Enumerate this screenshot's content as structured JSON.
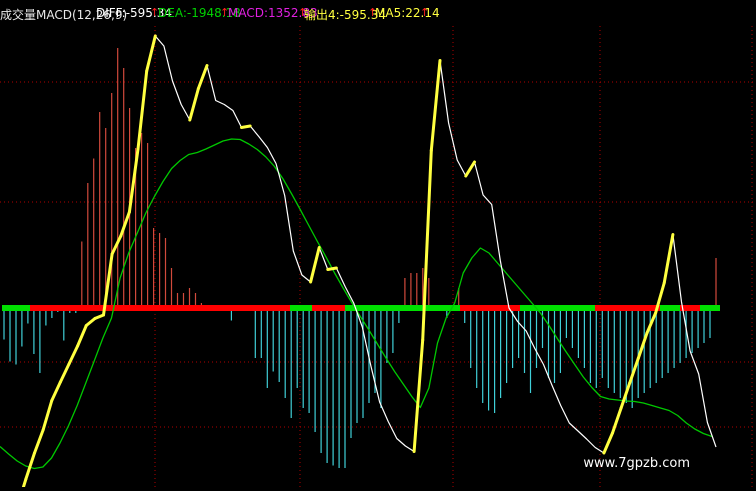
{
  "legend": {
    "title": "成交量MACD(12,26,9)",
    "diff": "DIFF:-595.34",
    "dea": "DEA:-1948.18",
    "macd": "MACD:1352.83",
    "out4": "输出4:-595.34",
    "ma5": "MA5:22.14"
  },
  "watermark": "www.7gpzb.com",
  "colors": {
    "background": "#000000",
    "title": "#e8e8e8",
    "diff": "#ffffff",
    "dea": "#00d000",
    "macd": "#e020e0",
    "out4": "#ffff40",
    "ma5": "#ffff40",
    "bar_positive": "#d24a3c",
    "bar_negative": "#40d0d8",
    "zero_red": "#ff0000",
    "zero_green": "#00e000",
    "line_yellow": "#ffff40",
    "line_white": "#ffffff",
    "line_green": "#00c800",
    "grid": "#b00000"
  },
  "chart_data": {
    "type": "line",
    "title": "成交量MACD(12,26,9)",
    "ylim": [
      -6000,
      6200
    ],
    "grid": true,
    "series": [
      {
        "name": "DIFF",
        "kind": "line",
        "values": [
          -3840,
          -3840,
          -3980,
          -3420,
          -2900,
          -2440,
          -1850,
          -1480,
          -1120,
          -760,
          -350,
          -210,
          -140,
          1080,
          1440,
          1920,
          3180,
          4740,
          5440,
          5240,
          4540,
          4070,
          3760,
          4390,
          4850,
          4150,
          4070,
          3950,
          3610,
          3640,
          3430,
          3210,
          2890,
          2250,
          1140,
          660,
          520,
          1210,
          770,
          800,
          430,
          100,
          -380,
          -1160,
          -1880,
          -2270,
          -2610,
          -2760,
          -2870,
          -640,
          3150,
          4950,
          3700,
          2960,
          2640,
          2920,
          2260,
          2070,
          950,
          0,
          -270,
          -460,
          -810,
          -1130,
          -1550,
          -1950,
          -2300,
          -2460,
          -2620,
          -2790,
          -2900,
          -2500,
          -2000,
          -1500,
          -1000,
          -500,
          -100,
          500,
          1470,
          120,
          -860,
          -1320,
          -2290,
          -2780
        ]
      },
      {
        "name": "DEA",
        "kind": "line",
        "values": [
          -2770,
          -2920,
          -3060,
          -3160,
          -3210,
          -3180,
          -3000,
          -2700,
          -2350,
          -1950,
          -1500,
          -1050,
          -600,
          -200,
          600,
          1100,
          1500,
          1900,
          2230,
          2530,
          2790,
          2950,
          3070,
          3110,
          3180,
          3260,
          3340,
          3380,
          3370,
          3280,
          3170,
          3020,
          2830,
          2580,
          2280,
          1970,
          1650,
          1330,
          1020,
          700,
          400,
          110,
          -170,
          -440,
          -720,
          -1000,
          -1270,
          -1520,
          -1770,
          -1990,
          -1600,
          -700,
          -200,
          100,
          700,
          1000,
          1200,
          1100,
          900,
          700,
          500,
          300,
          100,
          -100,
          -350,
          -620,
          -880,
          -1130,
          -1380,
          -1590,
          -1770,
          -1820,
          -1840,
          -1860,
          -1870,
          -1900,
          -1950,
          -2000,
          -2050,
          -2150,
          -2300,
          -2420,
          -2510,
          -2570
        ]
      },
      {
        "name": "MACD",
        "kind": "bar",
        "values": [
          -630,
          -1070,
          -1130,
          -770,
          -310,
          -920,
          -1300,
          -350,
          -200,
          -80,
          -650,
          -100,
          -100,
          1330,
          2500,
          2990,
          3920,
          3600,
          4300,
          5200,
          4800,
          4000,
          3200,
          3500,
          3300,
          1600,
          1500,
          1400,
          800,
          300,
          300,
          400,
          300,
          100,
          0,
          0,
          0,
          0,
          -250,
          0,
          0,
          0,
          -1000,
          -1000,
          -1600,
          -1270,
          -1480,
          -1800,
          -2200,
          -1600,
          -2000,
          -2100,
          -2480,
          -2900,
          -3100,
          -3150,
          -3200,
          -3200,
          -2600,
          -2300,
          -2200,
          -1900,
          -1700,
          -2000,
          -1100,
          -900,
          -300,
          600,
          700,
          700,
          800,
          600,
          0,
          0,
          -200,
          0,
          400,
          -300,
          -1200,
          -1600,
          -1900,
          -2050,
          -2100,
          -1800,
          -1500,
          -1200,
          -1000,
          -1300,
          -1700,
          -1200,
          -800,
          -1400,
          -1500,
          -1300,
          -600,
          -800,
          -1000,
          -1200,
          -1500,
          -1600,
          -1400,
          -1600,
          -1700,
          -1800,
          -1900,
          -2000,
          -1800,
          -1700,
          -1600,
          -1500,
          -1400,
          -1300,
          -1200,
          -1100,
          -1000,
          -900,
          -800,
          -700,
          -600,
          1000
        ]
      },
      {
        "name": "ZERO",
        "kind": "zero-axis",
        "value": 0
      }
    ]
  }
}
